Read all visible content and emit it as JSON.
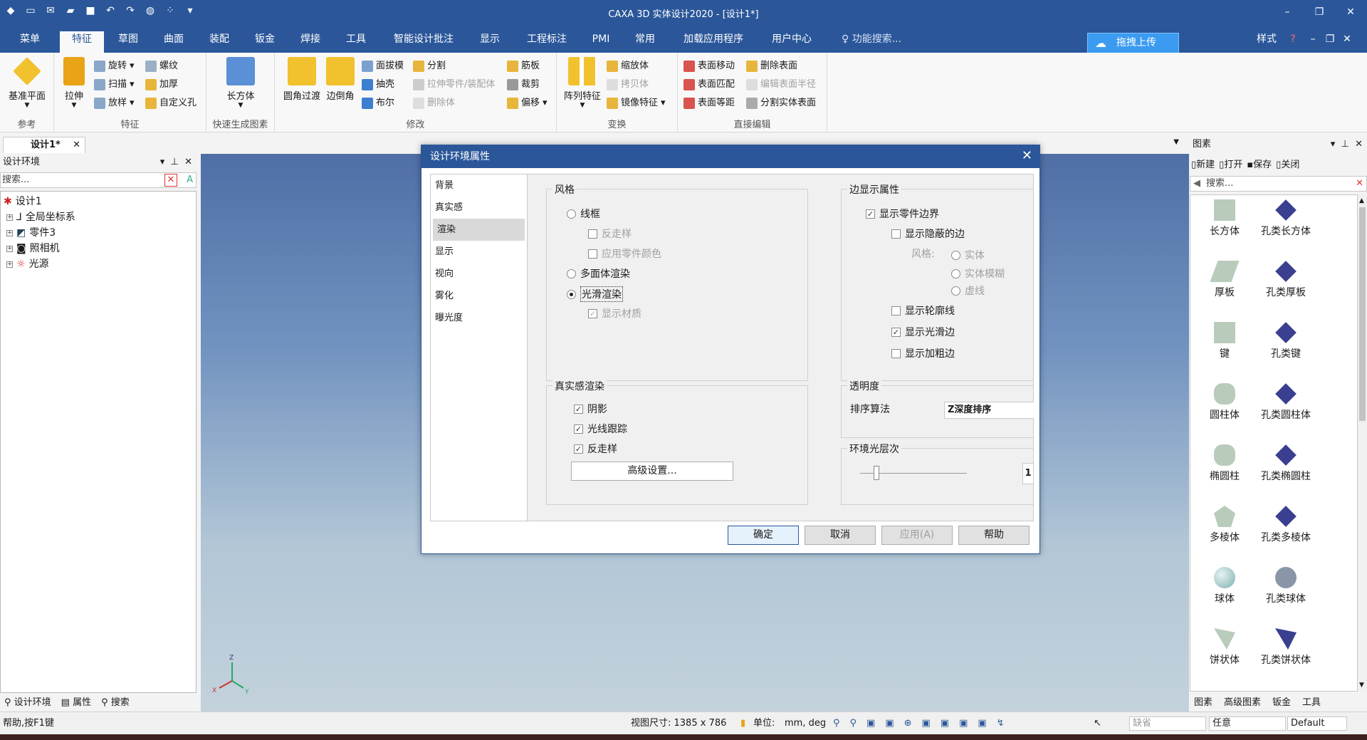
{
  "window": {
    "title": "CAXA 3D 实体设计2020 - [设计1*]",
    "controls": {
      "minimize": "–",
      "restore": "❐",
      "close": "✕"
    }
  },
  "ribbon_tabs": [
    "菜单",
    "特征",
    "草图",
    "曲面",
    "装配",
    "钣金",
    "焊接",
    "工具",
    "智能设计批注",
    "显示",
    "工程标注",
    "PMI",
    "常用",
    "加载应用程序",
    "用户中心"
  ],
  "active_tab": "特征",
  "search_placeholder": "功能搜索...",
  "upload_button": "拖拽上传",
  "style_menu": "样式",
  "ribbon": {
    "reference": {
      "label": "参考",
      "plane": "基准平面"
    },
    "feature": {
      "label": "特征",
      "extrude": "拉伸",
      "revolve": "旋转",
      "thread": "螺纹",
      "sweep": "扫描",
      "thicken": "加厚",
      "loft": "放样",
      "custom_hole": "自定义孔"
    },
    "quick": {
      "label": "快速生成图素",
      "box": "长方体"
    },
    "modify": {
      "label": "修改",
      "fillet": "圆角过渡",
      "chamfer": "边倒角",
      "draft": "面拔模",
      "shell": "抽壳",
      "boolean": "布尔",
      "split": "分割",
      "extrude_part": "拉伸零件/装配体",
      "delete_body": "删除体",
      "rib": "筋板",
      "trim": "裁剪",
      "offset": "偏移"
    },
    "transform": {
      "label": "变换",
      "pattern": "阵列特征",
      "scale": "缩放体",
      "copy": "拷贝体",
      "mirror": "镜像特征"
    },
    "direct": {
      "label": "直接编辑",
      "move_face": "表面移动",
      "match_face": "表面匹配",
      "equal_face": "表面等距",
      "delete_face": "删除表面",
      "edit_radius": "编辑表面半径",
      "split_face": "分割实体表面"
    }
  },
  "doc_tab": "设计1*",
  "left_panel": {
    "title": "设计环境",
    "search_placeholder": "搜索...",
    "tree": {
      "root": "设计1",
      "children": [
        "全局坐标系",
        "零件3",
        "照相机",
        "光源"
      ]
    },
    "tabs": [
      "设计环境",
      "属性",
      "搜索"
    ]
  },
  "dialog": {
    "title": "设计环境属性",
    "nav": [
      "背景",
      "真实感",
      "渲染",
      "显示",
      "视向",
      "雾化",
      "曝光度"
    ],
    "selected_nav": "渲染",
    "style_group": {
      "title": "风格",
      "wireframe": "线框",
      "antialias": "反走样",
      "use_part_color": "应用零件颜色",
      "polygon": "多面体渲染",
      "smooth": "光滑渲染",
      "show_material": "显示材质"
    },
    "edge_group": {
      "title": "边显示属性",
      "show_part_edges": "显示零件边界",
      "show_hidden": "显示隐蔽的边",
      "style_label": "风格:",
      "solid": "实体",
      "solid_blur": "实体模糊",
      "dashed": "虚线",
      "show_silhouette": "显示轮廓线",
      "show_smooth_edges": "显示光滑边",
      "show_bold_edges": "显示加粗边"
    },
    "realistic_group": {
      "title": "真实感渲染",
      "shadow": "阴影",
      "raytrace": "光线跟踪",
      "antialias": "反走样",
      "advanced": "高级设置..."
    },
    "transparency": {
      "title": "透明度",
      "sort_label": "排序算法",
      "sort_value": "Z深度排序"
    },
    "ambient": {
      "title": "环境光层次",
      "value": "1",
      "level": 0.15
    },
    "buttons": {
      "ok": "确定",
      "cancel": "取消",
      "apply": "应用(A)",
      "help": "帮助"
    }
  },
  "right_panel": {
    "title": "图素",
    "toolbar": {
      "new": "新建",
      "open": "打开",
      "save": "保存",
      "close": "关闭"
    },
    "search_placeholder": "搜索...",
    "shapes": [
      "长方体",
      "孔类长方体",
      "厚板",
      "孔类厚板",
      "键",
      "孔类键",
      "圆柱体",
      "孔类圆柱体",
      "椭圆柱",
      "孔类椭圆柱",
      "多棱体",
      "孔类多棱体",
      "球体",
      "孔类球体",
      "饼状体",
      "孔类饼状体"
    ],
    "tabs": [
      "图素",
      "高级图素",
      "钣金",
      "工具"
    ]
  },
  "status": {
    "help": "帮助,按F1键",
    "view_size": "视图尺寸: 1385 x 786",
    "unit_label": "单位:",
    "unit_value": "mm, deg",
    "filter_placeholder": "缺省",
    "select_mode": "任意",
    "scheme": "Default"
  },
  "axes": {
    "x": "X",
    "y": "Y",
    "z": "Z"
  },
  "colors": {
    "accent": "#2b579a",
    "upload": "#3b9bf0"
  }
}
